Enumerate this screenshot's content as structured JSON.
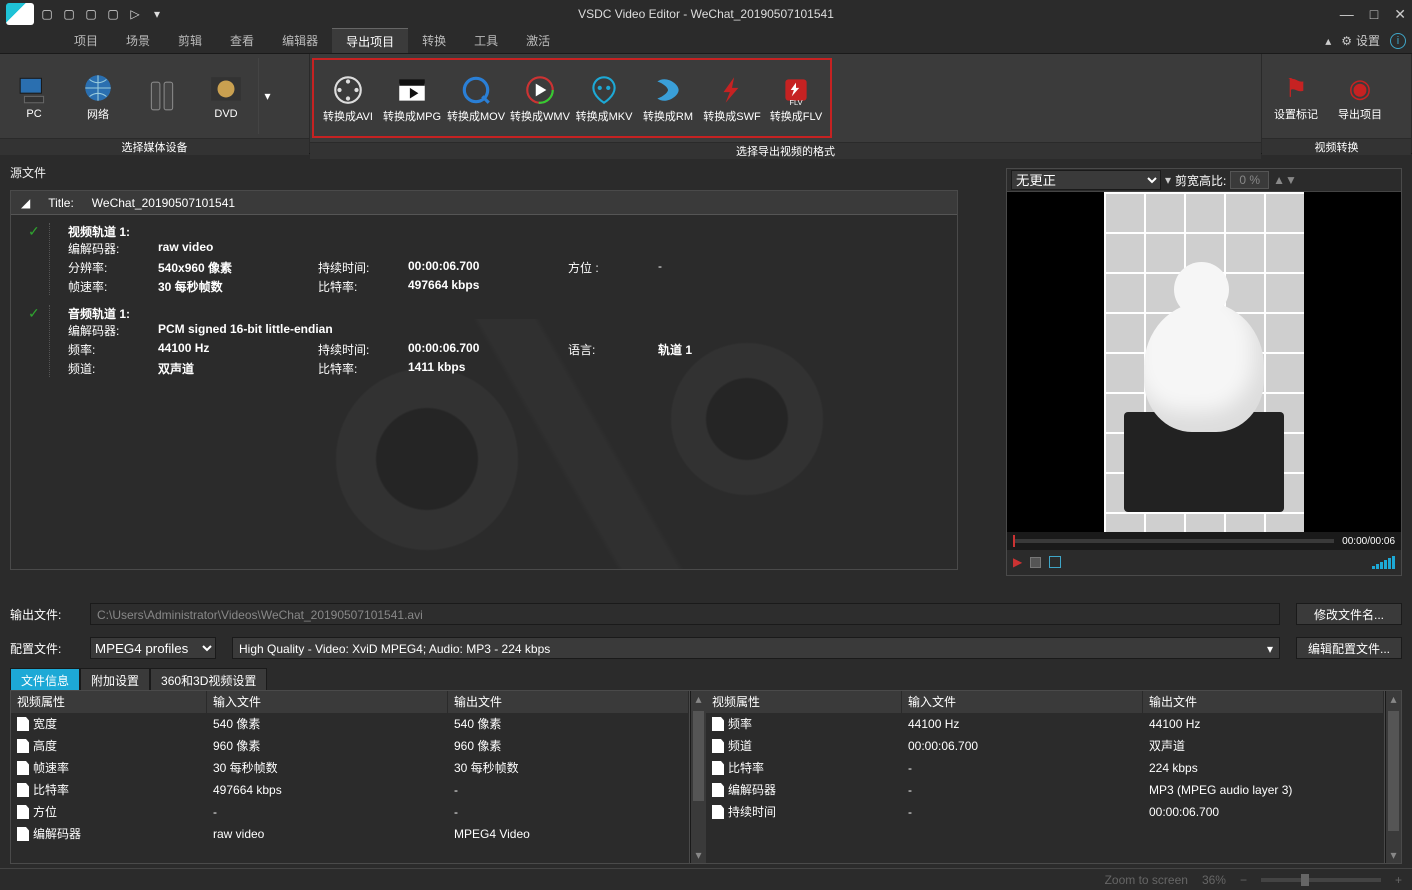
{
  "titlebar": {
    "title": "VSDC Video Editor - WeChat_20190507101541"
  },
  "menubar": {
    "items": [
      "项目",
      "场景",
      "剪辑",
      "查看",
      "编辑器",
      "导出项目",
      "转换",
      "工具",
      "激活"
    ],
    "active_index": 5,
    "settings": "设置"
  },
  "ribbon": {
    "group_device": {
      "label": "选择媒体设备",
      "items": [
        "PC",
        "网络",
        "",
        "DVD"
      ]
    },
    "group_format": {
      "label": "选择导出视频的格式",
      "items": [
        "转换成AVI",
        "转换成MPG",
        "转换成MOV",
        "转换成WMV",
        "转换成MKV",
        "转换成RM",
        "转换成SWF",
        "转换成FLV"
      ]
    },
    "group_convert": {
      "label": "视频转换",
      "items": [
        "设置标记",
        "导出项目"
      ]
    }
  },
  "source": {
    "panel_label": "源文件",
    "title_label": "Title:",
    "title_value": "WeChat_20190507101541",
    "video": {
      "head": "视频轨道 1:",
      "codec_k": "编解码器:",
      "codec_v": "raw video",
      "res_k": "分辨率:",
      "res_v": "540x960 像素",
      "fps_k": "帧速率:",
      "fps_v": "30 每秒帧数",
      "dur_k": "持续时间:",
      "dur_v": "00:00:06.700",
      "bit_k": "比特率:",
      "bit_v": "497664 kbps",
      "ori_k": "方位 :",
      "ori_v": "-"
    },
    "audio": {
      "head": "音频轨道 1:",
      "codec_k": "编解码器:",
      "codec_v": "PCM signed 16-bit little-endian",
      "freq_k": "频率:",
      "freq_v": "44100 Hz",
      "ch_k": "频道:",
      "ch_v": "双声道",
      "dur_k": "持续时间:",
      "dur_v": "00:00:06.700",
      "bit_k": "比特率:",
      "bit_v": "1411 kbps",
      "lang_k": "语言:",
      "lang_v": "轨道 1"
    }
  },
  "preview": {
    "correction_option": "无更正",
    "ratio_label": "剪宽高比:",
    "ratio_value": "0 %",
    "time": "00:00/00:06"
  },
  "output": {
    "out_label": "输出文件:",
    "out_path": "C:\\Users\\Administrator\\Videos\\WeChat_20190507101541.avi",
    "out_btn": "修改文件名...",
    "cfg_label": "配置文件:",
    "cfg_profile": "MPEG4 profiles",
    "cfg_quality": "High Quality - Video: XviD MPEG4; Audio: MP3 - 224 kbps",
    "cfg_btn": "编辑配置文件..."
  },
  "tabs": [
    "文件信息",
    "附加设置",
    "360和3D视频设置"
  ],
  "info_headers": [
    "视频属性",
    "输入文件",
    "输出文件"
  ],
  "info_left": [
    [
      "宽度",
      "540 像素",
      "540 像素"
    ],
    [
      "高度",
      "960 像素",
      "960 像素"
    ],
    [
      "帧速率",
      "30 每秒帧数",
      "30 每秒帧数"
    ],
    [
      "比特率",
      "497664 kbps",
      "-"
    ],
    [
      "方位",
      "-",
      "-"
    ],
    [
      "编解码器",
      "raw video",
      "MPEG4 Video"
    ]
  ],
  "info_right": [
    [
      "频率",
      "44100 Hz",
      "44100 Hz"
    ],
    [
      "频道",
      "00:00:06.700",
      "双声道"
    ],
    [
      "比特率",
      "-",
      "224 kbps"
    ],
    [
      "编解码器",
      "-",
      "MP3 (MPEG audio layer 3)"
    ],
    [
      "持续时间",
      "-",
      "00:00:06.700"
    ]
  ],
  "statusbar": {
    "zoom_label": "Zoom to screen",
    "zoom_val": "36%"
  }
}
